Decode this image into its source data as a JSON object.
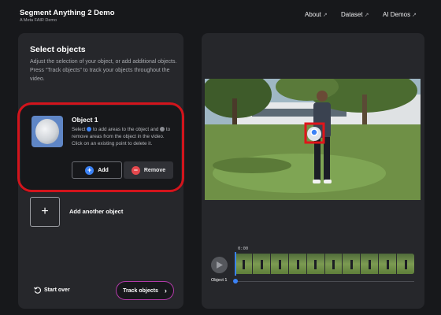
{
  "header": {
    "title": "Segment Anything 2 Demo",
    "subtitle": "A Meta FAIR Demo",
    "nav": [
      {
        "label": "About",
        "icon": "external-arrow-icon"
      },
      {
        "label": "Dataset",
        "icon": "external-arrow-icon"
      },
      {
        "label": "AI Demos",
        "icon": "external-arrow-icon"
      }
    ]
  },
  "left_panel": {
    "title": "Select objects",
    "description": "Adjust the selection of your object, or add additional objects. Press “Track objects” to track your objects throughout the video.",
    "object": {
      "title": "Object 1",
      "desc_part1": "Select",
      "desc_part2": "to add areas to the object and",
      "desc_part3": "to remove areas from the object in the video. Click on an existing point to delete it.",
      "add_label": "Add",
      "remove_label": "Remove"
    },
    "add_another_label": "Add another object",
    "start_over_label": "Start over",
    "track_label": "Track objects"
  },
  "player": {
    "time": "0:00",
    "track_name": "Object 1"
  },
  "colors": {
    "accent_blue": "#3b82f6",
    "remove_red": "#e5484d",
    "highlight_red": "#d3141c",
    "track_gradient": "#b23aa8"
  }
}
